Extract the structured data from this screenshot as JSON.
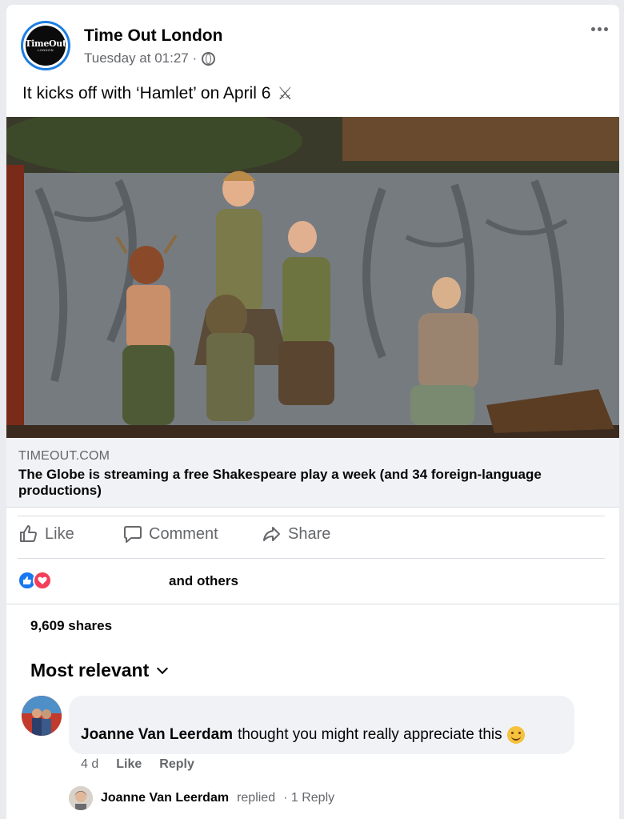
{
  "post": {
    "page_name": "Time Out London",
    "timestamp": "Tuesday at 01:27 ·",
    "privacy_icon": "globe-icon",
    "logo": {
      "main": "TimeOut",
      "sub": "LONDON"
    },
    "text": "It kicks off with ‘Hamlet’ on April 6",
    "emoji": "⚔"
  },
  "link": {
    "domain": "TIMEOUT.COM",
    "title": "The Globe is streaming a free Shakespeare play a week (and 34 foreign-language productions)"
  },
  "actions": {
    "like": "Like",
    "comment": "Comment",
    "share": "Share"
  },
  "reactions": {
    "text": "and others",
    "types": [
      "like",
      "love"
    ]
  },
  "shares": "9,609 shares",
  "sort": {
    "label": "Most relevant"
  },
  "comment": {
    "author": "Joanne Van Leerdam",
    "text": "thought you might really appreciate this",
    "age": "4 d",
    "like": "Like",
    "reply": "Reply"
  },
  "reply_summary": {
    "author": "Joanne Van Leerdam",
    "verb": "replied",
    "count": "· 1 Reply"
  },
  "colors": {
    "accent": "#1877f2",
    "love": "#f33e58",
    "muted": "#65676b",
    "avatar_ring": "#1d7de0"
  }
}
